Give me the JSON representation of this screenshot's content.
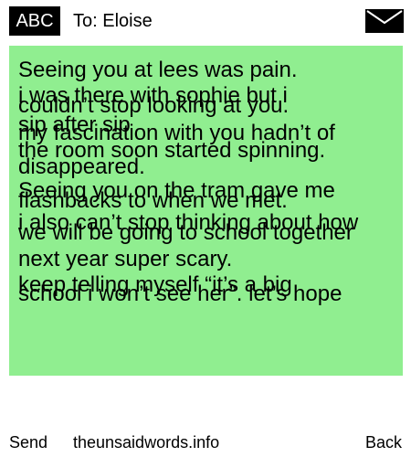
{
  "header": {
    "keyboard_mode": "ABC",
    "to_label": "To: Eloise",
    "envelope_icon": "envelope-icon"
  },
  "message": {
    "background_color": "#90ee90",
    "lines": [
      "Seeing you at lees was pain.",
      "i was there with sophie but i",
      "couldn’t stop looking at you.",
      "sip after sip",
      "my fascination with you hadn’t of",
      "the room soon started spinning.",
      "disappeared.",
      "Seeing you on the tram gave me",
      "flashbacks to when we met.",
      "i also can’t stop thinking about how",
      "we will be going to school together",
      "next year super scary.",
      "keep telling myself “it’s a big",
      "school i won’t see her”. let’s hope"
    ]
  },
  "footer": {
    "send_label": "Send",
    "site_label": "theunsaidwords.info",
    "back_label": "Back"
  }
}
